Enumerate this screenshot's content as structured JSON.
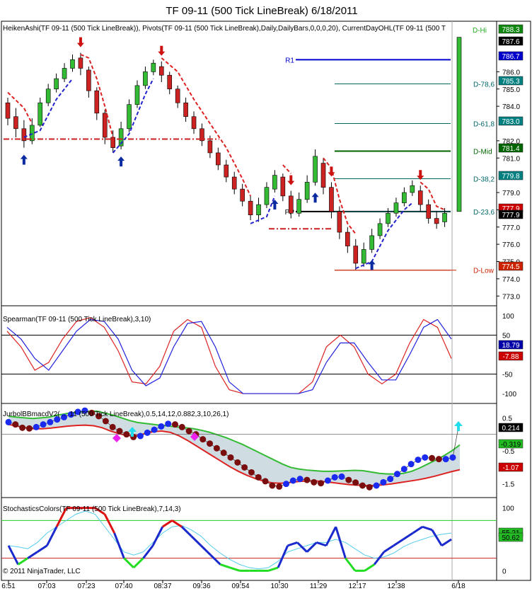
{
  "window_title": "TF 09-11 (500 Tick LineBreak)  6/18/2011",
  "copyright": "© 2011 NinjaTrader, LLC",
  "chart_data": [
    {
      "type": "candlestick",
      "panel": "price",
      "label": "HeikenAshi(TF 09-11 (500 Tick LineBreak)), Pivots(TF 09-11 (500 Tick LineBreak),Daily,DailyBars,0,0,0,20), CurrentDayOHL(TF 09-11 (500 T",
      "ylim": [
        772.6,
        788.6
      ],
      "yticks": [
        "786.0",
        "785.0",
        "784.0",
        "782.0",
        "781.0",
        "779.0",
        "778.0",
        "777.0",
        "776.0",
        "775.0",
        "774.0",
        "773.0"
      ],
      "candles": [
        {
          "o": 784.2,
          "c": 783.3,
          "h": 784.5,
          "l": 782.9
        },
        {
          "o": 783.4,
          "c": 782.7,
          "h": 783.9,
          "l": 782.2
        },
        {
          "o": 782.7,
          "c": 782.0,
          "h": 783.2,
          "l": 781.6
        },
        {
          "o": 782.0,
          "c": 782.9,
          "h": 783.3,
          "l": 781.8
        },
        {
          "o": 782.9,
          "c": 784.2,
          "h": 784.5,
          "l": 782.8
        },
        {
          "o": 784.2,
          "c": 785.0,
          "h": 785.3,
          "l": 784.0
        },
        {
          "o": 785.0,
          "c": 785.6,
          "h": 785.9,
          "l": 784.8
        },
        {
          "o": 785.6,
          "c": 786.2,
          "h": 786.5,
          "l": 785.4
        },
        {
          "o": 786.2,
          "c": 786.7,
          "h": 787.0,
          "l": 786.0
        },
        {
          "o": 786.8,
          "c": 786.2,
          "h": 787.1,
          "l": 785.8
        },
        {
          "o": 786.1,
          "c": 784.9,
          "h": 786.3,
          "l": 784.5
        },
        {
          "o": 784.9,
          "c": 783.6,
          "h": 785.1,
          "l": 783.2
        },
        {
          "o": 783.6,
          "c": 782.2,
          "h": 783.8,
          "l": 781.8
        },
        {
          "o": 782.2,
          "c": 781.6,
          "h": 782.6,
          "l": 781.3
        },
        {
          "o": 781.7,
          "c": 782.7,
          "h": 783.1,
          "l": 781.5
        },
        {
          "o": 782.7,
          "c": 784.1,
          "h": 784.4,
          "l": 782.5
        },
        {
          "o": 784.1,
          "c": 785.2,
          "h": 785.5,
          "l": 783.9
        },
        {
          "o": 785.2,
          "c": 786.0,
          "h": 786.3,
          "l": 785.0
        },
        {
          "o": 786.0,
          "c": 786.5,
          "h": 786.7,
          "l": 785.8
        },
        {
          "o": 786.3,
          "c": 785.8,
          "h": 786.6,
          "l": 785.4
        },
        {
          "o": 785.8,
          "c": 785.0,
          "h": 786.0,
          "l": 784.7
        },
        {
          "o": 785.0,
          "c": 784.2,
          "h": 785.2,
          "l": 783.9
        },
        {
          "o": 784.2,
          "c": 783.4,
          "h": 784.5,
          "l": 783.1
        },
        {
          "o": 783.4,
          "c": 782.7,
          "h": 783.7,
          "l": 782.4
        },
        {
          "o": 782.7,
          "c": 782.0,
          "h": 783.0,
          "l": 781.7
        },
        {
          "o": 782.0,
          "c": 781.3,
          "h": 782.3,
          "l": 781.0
        },
        {
          "o": 781.3,
          "c": 780.6,
          "h": 781.6,
          "l": 780.3
        },
        {
          "o": 780.6,
          "c": 779.9,
          "h": 780.9,
          "l": 779.6
        },
        {
          "o": 779.9,
          "c": 779.2,
          "h": 780.2,
          "l": 778.9
        },
        {
          "o": 779.2,
          "c": 778.5,
          "h": 779.5,
          "l": 778.2
        },
        {
          "o": 778.5,
          "c": 777.7,
          "h": 778.8,
          "l": 777.4
        },
        {
          "o": 777.7,
          "c": 778.3,
          "h": 778.7,
          "l": 777.3
        },
        {
          "o": 778.3,
          "c": 779.3,
          "h": 779.6,
          "l": 778.1
        },
        {
          "o": 779.2,
          "c": 780.0,
          "h": 780.3,
          "l": 779.0
        },
        {
          "o": 779.9,
          "c": 778.8,
          "h": 780.1,
          "l": 778.5
        },
        {
          "o": 778.8,
          "c": 777.8,
          "h": 779.1,
          "l": 777.5
        },
        {
          "o": 777.8,
          "c": 778.6,
          "h": 779.0,
          "l": 777.6
        },
        {
          "o": 778.6,
          "c": 779.6,
          "h": 780.0,
          "l": 778.4
        },
        {
          "o": 779.6,
          "c": 781.1,
          "h": 781.5,
          "l": 779.4
        },
        {
          "o": 780.7,
          "c": 779.3,
          "h": 781.0,
          "l": 778.9
        },
        {
          "o": 779.3,
          "c": 777.9,
          "h": 779.6,
          "l": 777.5
        },
        {
          "o": 777.9,
          "c": 776.7,
          "h": 778.2,
          "l": 776.3
        },
        {
          "o": 776.7,
          "c": 775.9,
          "h": 777.0,
          "l": 775.5
        },
        {
          "o": 775.9,
          "c": 774.9,
          "h": 776.3,
          "l": 774.5
        },
        {
          "o": 774.9,
          "c": 775.7,
          "h": 776.1,
          "l": 774.7
        },
        {
          "o": 775.7,
          "c": 776.5,
          "h": 776.9,
          "l": 775.5
        },
        {
          "o": 776.5,
          "c": 777.2,
          "h": 777.5,
          "l": 776.3
        },
        {
          "o": 777.2,
          "c": 777.8,
          "h": 778.1,
          "l": 777.0
        },
        {
          "o": 777.8,
          "c": 778.4,
          "h": 778.7,
          "l": 777.6
        },
        {
          "o": 778.4,
          "c": 779.0,
          "h": 779.3,
          "l": 778.2
        },
        {
          "o": 779.0,
          "c": 779.4,
          "h": 779.7,
          "l": 778.8
        },
        {
          "o": 779.1,
          "c": 778.3,
          "h": 779.4,
          "l": 777.9
        },
        {
          "o": 778.3,
          "c": 777.5,
          "h": 778.6,
          "l": 777.2
        },
        {
          "o": 777.5,
          "c": 777.2,
          "h": 777.9,
          "l": 776.9
        },
        {
          "o": 777.3,
          "c": 777.8,
          "h": 778.1,
          "l": 777.0
        }
      ],
      "current_day_bar": {
        "o": 777.9,
        "h": 788.0,
        "c": 778.0
      },
      "levels": [
        {
          "name": "R1",
          "value": 786.7,
          "color": "#0000cc",
          "label_pos": "left"
        },
        {
          "name": "PP",
          "value": 777.9,
          "color": "#000000",
          "label_pos": "left"
        },
        {
          "name": "D-Mid",
          "value": 781.4,
          "color": "#006400",
          "label_pos": "right"
        },
        {
          "name": "D-78,6",
          "value": 785.3,
          "color": "#006666",
          "label_pos": "right"
        },
        {
          "name": "D-61,8",
          "value": 783.0,
          "color": "#006666",
          "label_pos": "right"
        },
        {
          "name": "D-38,2",
          "value": 779.8,
          "color": "#006666",
          "label_pos": "right"
        },
        {
          "name": "D-23,6",
          "value": 777.9,
          "color": "#006666",
          "label_pos": "right"
        },
        {
          "name": "D-Low",
          "value": 774.5,
          "color": "#cc2200",
          "label_pos": "right"
        },
        {
          "name": "D-Hi",
          "value": 788.0,
          "color": "#22aa22",
          "label_pos": "right"
        }
      ],
      "axis_badges": [
        {
          "text": "788.3",
          "bg": "#118811",
          "fg": "#ffffff"
        },
        {
          "text": "787.6",
          "bg": "#000000",
          "fg": "#ffffff"
        },
        {
          "text": "786.7",
          "bg": "#0000cc",
          "fg": "#ffffff"
        },
        {
          "text": "785.3",
          "bg": "#008080",
          "fg": "#ffffff"
        },
        {
          "text": "783.0",
          "bg": "#008080",
          "fg": "#ffffff"
        },
        {
          "text": "781.4",
          "bg": "#006400",
          "fg": "#ffffff"
        },
        {
          "text": "779.8",
          "bg": "#008080",
          "fg": "#ffffff"
        },
        {
          "text": "777.9",
          "bg": "#cc0000",
          "fg": "#ffffff"
        },
        {
          "text": "777.9",
          "bg": "#000000",
          "fg": "#ffffff"
        },
        {
          "text": "774.5",
          "bg": "#cc2200",
          "fg": "#ffffff"
        }
      ],
      "up_arrows": [
        2,
        14,
        33,
        38,
        45
      ],
      "down_arrows": [
        9,
        19,
        35,
        40,
        51
      ]
    },
    {
      "type": "line",
      "panel": "spearman",
      "label": "Spearman(TF 09-11 (500 Tick LineBreak),3,10)",
      "ylim": [
        -118,
        118
      ],
      "yticks": [
        "100",
        "50",
        "-50",
        "-100"
      ],
      "hlines": [
        50,
        -50
      ],
      "series": [
        {
          "color": "#dd2222",
          "values": [
            60,
            20,
            -40,
            -20,
            40,
            85,
            95,
            70,
            10,
            -70,
            -75,
            -30,
            60,
            90,
            70,
            -30,
            -90,
            -100,
            -100,
            -100,
            -100,
            -100,
            -70,
            20,
            50,
            20,
            -50,
            -75,
            -50,
            30,
            90,
            70,
            -10
          ]
        },
        {
          "color": "#2222dd",
          "values": [
            70,
            40,
            -10,
            -40,
            10,
            60,
            90,
            85,
            40,
            -40,
            -80,
            -60,
            20,
            80,
            85,
            20,
            -70,
            -100,
            -100,
            -100,
            -100,
            -100,
            -90,
            -20,
            30,
            30,
            -20,
            -65,
            -65,
            0,
            70,
            90,
            40
          ]
        }
      ],
      "badges": [
        {
          "text": "18.79",
          "bg": "#0000aa"
        },
        {
          "text": "-7.88",
          "bg": "#cc0000"
        }
      ]
    },
    {
      "type": "line",
      "panel": "jurbol",
      "label": "JurbolBBmacdV2( ... 11 (500 Tick LineBreak),0.5,14,12,0.882,3,10,26,1)",
      "ylim": [
        -1.85,
        0.85
      ],
      "yticks": [
        "0.5",
        "-0.5",
        "-1.5"
      ],
      "dots": [
        0.37,
        0.3,
        0.2,
        0.18,
        0.22,
        0.3,
        0.37,
        0.45,
        0.52,
        0.6,
        0.68,
        0.72,
        0.65,
        0.55,
        0.4,
        0.22,
        0.1,
        0.0,
        -0.08,
        -0.05,
        0.05,
        0.14,
        0.24,
        0.32,
        0.3,
        0.22,
        0.1,
        0.0,
        -0.15,
        -0.28,
        -0.42,
        -0.56,
        -0.7,
        -0.85,
        -1.0,
        -1.15,
        -1.3,
        -1.42,
        -1.55,
        -1.58,
        -1.5,
        -1.4,
        -1.35,
        -1.38,
        -1.45,
        -1.48,
        -1.4,
        -1.3,
        -1.28,
        -1.38,
        -1.46,
        -1.55,
        -1.6,
        -1.55,
        -1.45,
        -1.35,
        -1.2,
        -1.05,
        -0.9,
        -0.77,
        -0.7,
        -0.72,
        -0.75,
        -0.75,
        -0.7,
        0.214
      ],
      "upper": [
        0.55,
        0.52,
        0.5,
        0.48,
        0.5,
        0.52,
        0.58,
        0.62,
        0.66,
        0.68,
        0.7,
        0.7,
        0.64,
        0.58,
        0.5,
        0.42,
        0.36,
        0.33,
        0.3,
        0.27,
        0.25,
        0.22,
        0.2,
        0.17,
        0.12,
        0.06,
        -0.02,
        -0.1,
        -0.2,
        -0.3,
        -0.42,
        -0.54,
        -0.66,
        -0.78,
        -0.9,
        -1.0,
        -1.05,
        -1.08,
        -1.1,
        -1.12,
        -1.12,
        -1.11,
        -1.1,
        -1.09,
        -1.1,
        -1.14,
        -1.18,
        -1.2,
        -1.2,
        -1.18,
        -1.12,
        -1.02,
        -0.9,
        -0.78,
        -0.65,
        -0.5,
        -0.319
      ],
      "lower": [
        0.3,
        0.25,
        0.2,
        0.17,
        0.17,
        0.19,
        0.22,
        0.25,
        0.27,
        0.28,
        0.26,
        0.2,
        0.1,
        0.02,
        -0.04,
        -0.04,
        0.02,
        0.08,
        0.1,
        0.06,
        -0.04,
        -0.18,
        -0.34,
        -0.5,
        -0.66,
        -0.82,
        -0.98,
        -1.12,
        -1.24,
        -1.34,
        -1.42,
        -1.47,
        -1.48,
        -1.46,
        -1.43,
        -1.41,
        -1.41,
        -1.43,
        -1.46,
        -1.49,
        -1.52,
        -1.54,
        -1.55,
        -1.55,
        -1.53,
        -1.5,
        -1.46,
        -1.42,
        -1.38,
        -1.33,
        -1.27,
        -1.2,
        -1.13,
        -1.07
      ],
      "badges": [
        {
          "text": "0.214",
          "bg": "#000000",
          "fg": "#ffffff"
        },
        {
          "text": "-0.319",
          "bg": "#22bb22",
          "fg": "#000000"
        },
        {
          "text": "-1.07",
          "bg": "#cc0000",
          "fg": "#ffffff"
        }
      ]
    },
    {
      "type": "line",
      "panel": "stochastics",
      "label": "StochasticsColors(TF 09-11 (500 Tick LineBreak),7,14,3)",
      "ylim": [
        -12,
        112
      ],
      "yticks": [
        "100",
        "0"
      ],
      "hlines": [
        80,
        20
      ],
      "k": [
        40,
        10,
        20,
        30,
        40,
        70,
        100,
        100,
        100,
        100,
        90,
        60,
        20,
        5,
        20,
        40,
        70,
        80,
        70,
        55,
        40,
        25,
        10,
        5,
        0,
        0,
        0,
        0,
        5,
        40,
        45,
        30,
        45,
        40,
        70,
        20,
        0,
        0,
        10,
        30,
        40,
        50,
        60,
        70,
        65,
        40,
        50
      ],
      "d": [
        40,
        38,
        35,
        45,
        60,
        70,
        80,
        90,
        95,
        90,
        70,
        50,
        30,
        25,
        30,
        45,
        60,
        70,
        72,
        65,
        55,
        40,
        28,
        18,
        10,
        5,
        3,
        5,
        15,
        30,
        35,
        40,
        45,
        45,
        50,
        45,
        35,
        25,
        20,
        22,
        28,
        38,
        45,
        50,
        55,
        58,
        60
      ],
      "badges": [
        {
          "text": "55.21",
          "bg": "#22bb22",
          "fg": "#000000"
        },
        {
          "text": "50.62",
          "bg": "#22bb22",
          "fg": "#000000"
        }
      ]
    }
  ],
  "x_axis_labels": [
    "6:51",
    "07:03",
    "07:23",
    "07:40",
    "08:37",
    "09:36",
    "09:54",
    "10:30",
    "11:29",
    "12:17",
    "12:38",
    "6/18"
  ]
}
